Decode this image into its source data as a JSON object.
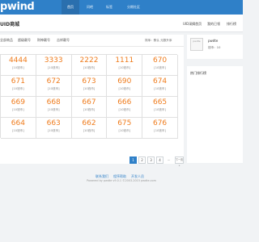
{
  "header": {
    "logo": "pwind",
    "nav": [
      "首页",
      "问吧",
      "标签",
      "分期社区"
    ]
  },
  "subheader": {
    "title": "UID商城",
    "links": [
      "UID采摘首页",
      "我的已领",
      "排行榜"
    ]
  },
  "tabs": [
    "全部商品",
    "超级靓号",
    "财神靓号",
    "吉祥靓号"
  ],
  "sort_label": "排序：默认 元数升序",
  "grid": [
    [
      {
        "num": "4444",
        "label": "[10钱币]"
      },
      {
        "num": "3333",
        "label": "[10钱币]"
      },
      {
        "num": "2222",
        "label": "[10钱币]"
      },
      {
        "num": "1111",
        "label": "[10钱币]"
      },
      {
        "num": "670",
        "label": "[10钱币]"
      }
    ],
    [
      {
        "num": "671",
        "label": "[10钱币]"
      },
      {
        "num": "672",
        "label": "[10钱币]"
      },
      {
        "num": "673",
        "label": "[10钱币]"
      },
      {
        "num": "690",
        "label": "[10钱币]"
      },
      {
        "num": "674",
        "label": "[10钱币]"
      }
    ],
    [
      {
        "num": "669",
        "label": "[10钱币]"
      },
      {
        "num": "668",
        "label": "[10钱币]"
      },
      {
        "num": "667",
        "label": "[10钱币]"
      },
      {
        "num": "666",
        "label": "[10钱币]"
      },
      {
        "num": "665",
        "label": "[10钱币]"
      }
    ],
    [
      {
        "num": "664",
        "label": "[10钱币]"
      },
      {
        "num": "663",
        "label": "[10钱币]"
      },
      {
        "num": "662",
        "label": "[10钱币]"
      },
      {
        "num": "675",
        "label": "[10钱币]"
      },
      {
        "num": "676",
        "label": "[10钱币]"
      }
    ]
  ],
  "pagination": {
    "pages": [
      "1",
      "2",
      "3",
      "4",
      "..."
    ],
    "next": "下一页 »",
    "current": "1"
  },
  "sidebar": {
    "avatar_alt": "pwdte",
    "username": "pwdte",
    "score": "钱币：10",
    "ranking_title": "热门排行榜"
  },
  "footer": {
    "links": [
      "联系我们",
      "程序帮助",
      "开发人员"
    ],
    "copyright": "Powered by pwdte v9.0.1 ©2003-2015 pwdte.com"
  }
}
